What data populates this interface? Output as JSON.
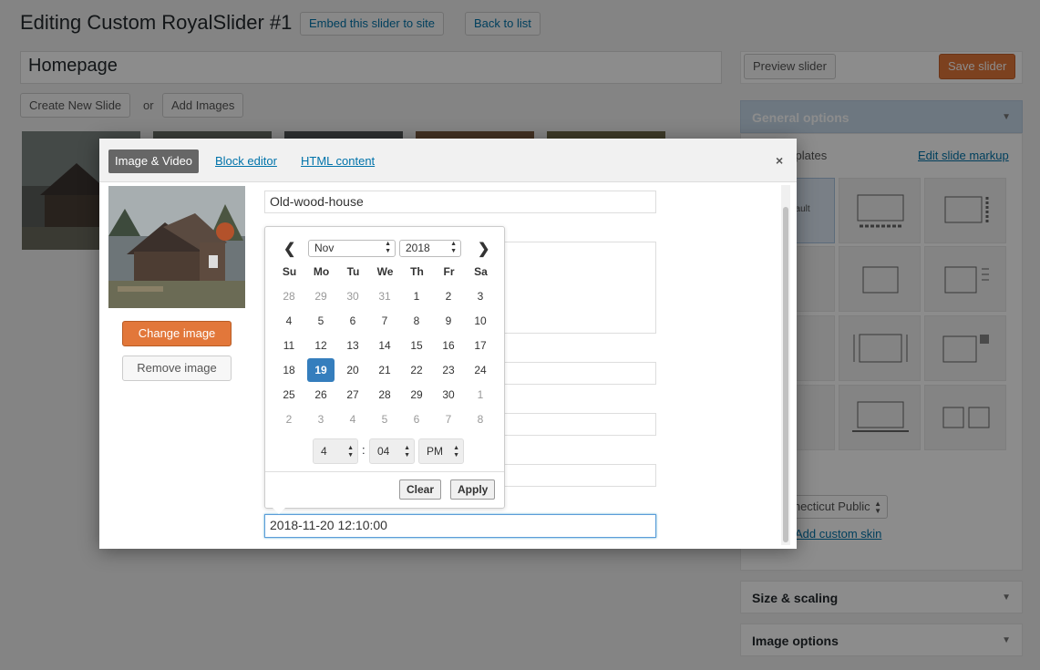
{
  "header": {
    "title": "Editing Custom RoyalSlider #1",
    "embed_label": "Embed this slider to site",
    "back_label": "Back to list"
  },
  "slider_name": "Homepage",
  "toolbar": {
    "create_slide_label": "Create New Slide",
    "or_text": "or",
    "add_images_label": "Add Images"
  },
  "sidebar": {
    "preview_label": "Preview slider",
    "save_label": "Save slider",
    "general_options": "General options",
    "templates_label": "Templates",
    "edit_markup_label": "Edit slide markup",
    "default_template_label": "Default",
    "skin_value": "Connecticut Public",
    "add_custom_skin_label": "Add custom skin",
    "size_scaling": "Size & scaling",
    "image_options": "Image options"
  },
  "modal": {
    "tabs": [
      "Image & Video",
      "Block editor",
      "HTML content"
    ],
    "close_icon": "×",
    "change_image_label": "Change image",
    "remove_image_label": "Remove image",
    "title_value": "Old-wood-house",
    "date_value": "2018-11-20 12:10:00"
  },
  "datepicker": {
    "prev_icon": "❮",
    "next_icon": "❯",
    "month": "Nov",
    "year": "2018",
    "weekdays": [
      "Su",
      "Mo",
      "Tu",
      "We",
      "Th",
      "Fr",
      "Sa"
    ],
    "weeks": [
      [
        {
          "d": "28",
          "off": true
        },
        {
          "d": "29",
          "off": true
        },
        {
          "d": "30",
          "off": true
        },
        {
          "d": "31",
          "off": true
        },
        {
          "d": "1"
        },
        {
          "d": "2"
        },
        {
          "d": "3"
        }
      ],
      [
        {
          "d": "4"
        },
        {
          "d": "5"
        },
        {
          "d": "6"
        },
        {
          "d": "7"
        },
        {
          "d": "8"
        },
        {
          "d": "9"
        },
        {
          "d": "10"
        }
      ],
      [
        {
          "d": "11"
        },
        {
          "d": "12"
        },
        {
          "d": "13"
        },
        {
          "d": "14"
        },
        {
          "d": "15"
        },
        {
          "d": "16"
        },
        {
          "d": "17"
        }
      ],
      [
        {
          "d": "18"
        },
        {
          "d": "19",
          "selected": true
        },
        {
          "d": "20"
        },
        {
          "d": "21"
        },
        {
          "d": "22"
        },
        {
          "d": "23"
        },
        {
          "d": "24"
        }
      ],
      [
        {
          "d": "25"
        },
        {
          "d": "26"
        },
        {
          "d": "27"
        },
        {
          "d": "28"
        },
        {
          "d": "29"
        },
        {
          "d": "30"
        },
        {
          "d": "1",
          "off": true
        }
      ],
      [
        {
          "d": "2",
          "off": true
        },
        {
          "d": "3",
          "off": true
        },
        {
          "d": "4",
          "off": true
        },
        {
          "d": "5",
          "off": true
        },
        {
          "d": "6",
          "off": true
        },
        {
          "d": "7",
          "off": true
        },
        {
          "d": "8",
          "off": true
        }
      ]
    ],
    "hour": "4",
    "minute": "04",
    "ampm": "PM",
    "colon": ":",
    "clear_label": "Clear",
    "apply_label": "Apply"
  },
  "colors": {
    "accent_orange": "#e2773a",
    "link_blue": "#0073aa",
    "selected_day": "#357ebd"
  }
}
